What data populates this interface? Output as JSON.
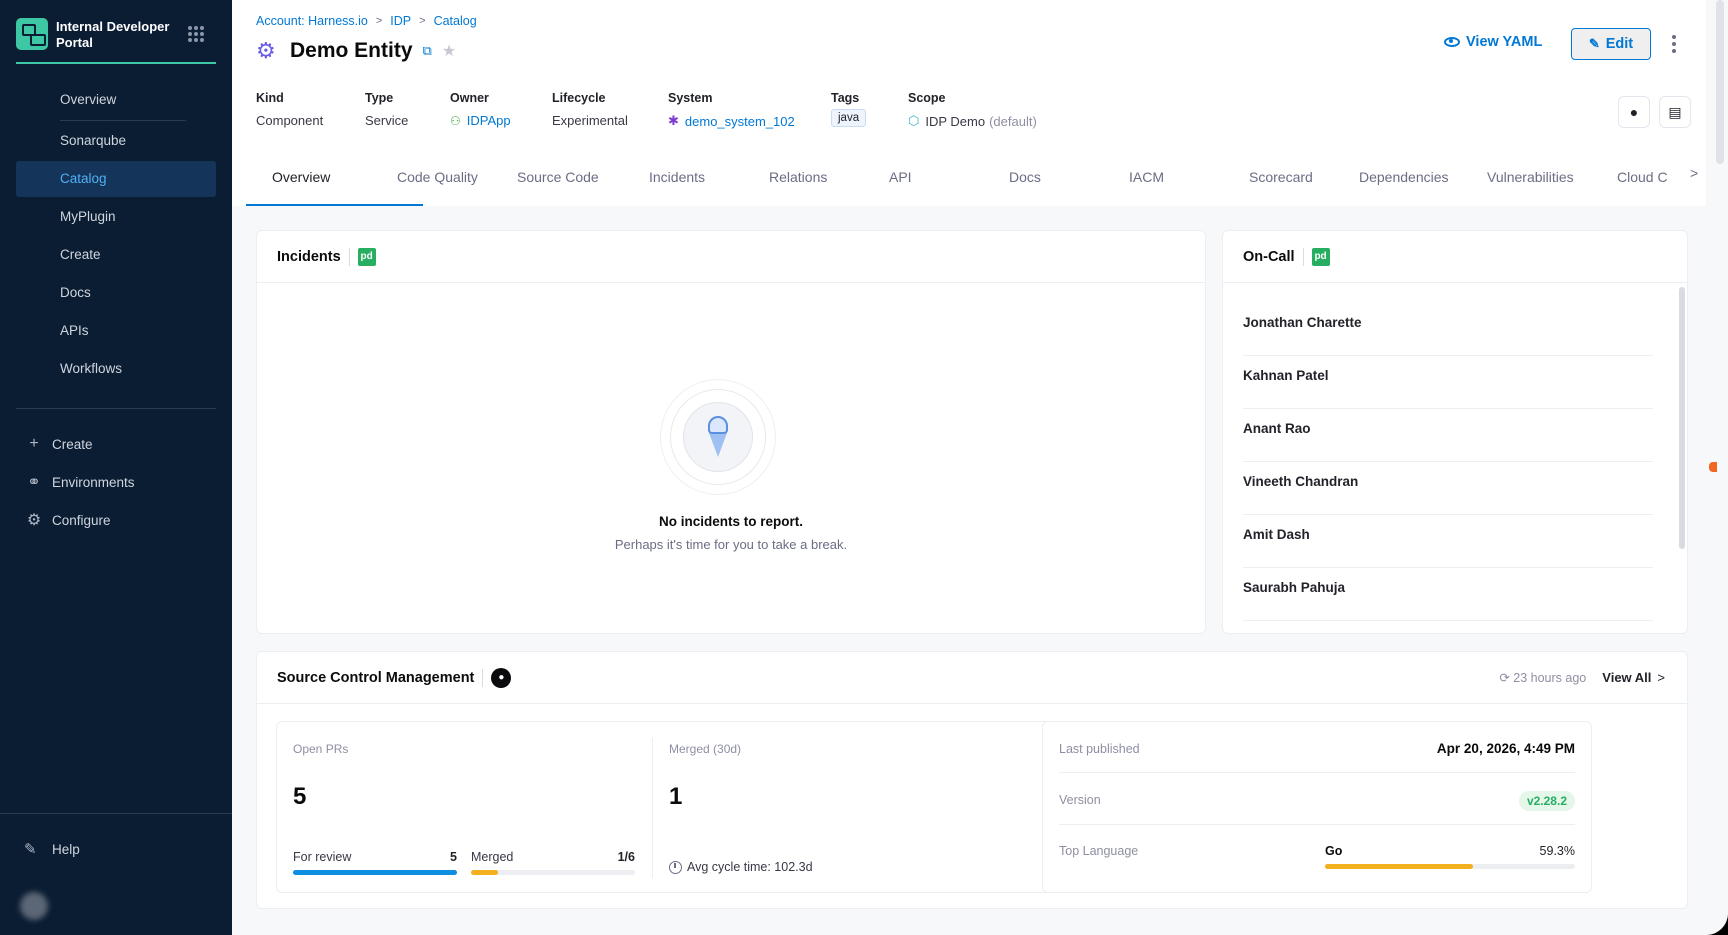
{
  "sidebar": {
    "brand": "Internal Developer Portal",
    "items": [
      {
        "label": "Overview"
      },
      {
        "label": "Sonarqube"
      },
      {
        "label": "Catalog"
      },
      {
        "label": "MyPlugin"
      },
      {
        "label": "Create"
      },
      {
        "label": "Docs"
      },
      {
        "label": "APIs"
      },
      {
        "label": "Workflows"
      }
    ],
    "active_item": "Catalog",
    "secondary": [
      {
        "label": "Create",
        "icon": "plus-icon"
      },
      {
        "label": "Environments",
        "icon": "environments-icon"
      },
      {
        "label": "Configure",
        "icon": "gear-icon"
      }
    ],
    "help": "Help"
  },
  "breadcrumb": [
    "Account: Harness.io",
    "IDP",
    "Catalog"
  ],
  "entity": {
    "title": "Demo Entity",
    "view_yaml": "View YAML",
    "edit": "Edit"
  },
  "meta": {
    "kind": {
      "label": "Kind",
      "value": "Component"
    },
    "type": {
      "label": "Type",
      "value": "Service"
    },
    "owner": {
      "label": "Owner",
      "value": "IDPApp"
    },
    "lifecycle": {
      "label": "Lifecycle",
      "value": "Experimental"
    },
    "system": {
      "label": "System",
      "value": "demo_system_102"
    },
    "tags": {
      "label": "Tags",
      "value": "java"
    },
    "scope": {
      "label": "Scope",
      "value": "IDP Demo",
      "suffix": "(default)"
    }
  },
  "tabs": [
    "Overview",
    "Code Quality",
    "Source Code",
    "Incidents",
    "Relations",
    "API",
    "Docs",
    "IACM",
    "Scorecard",
    "Dependencies",
    "Vulnerabilities",
    "Cloud C"
  ],
  "active_tab": "Overview",
  "incidents": {
    "title": "Incidents",
    "badge": "pd",
    "empty_title": "No incidents to report.",
    "empty_sub": "Perhaps it's time for you to take a break."
  },
  "oncall": {
    "title": "On-Call",
    "badge": "pd",
    "people": [
      "Jonathan Charette",
      "Kahnan Patel",
      "Anant Rao",
      "Vineeth Chandran",
      "Amit Dash",
      "Saurabh Pahuja"
    ]
  },
  "scm": {
    "title": "Source Control Management",
    "updated": "23 hours ago",
    "view_all": "View All",
    "open_prs": {
      "label": "Open PRs",
      "value": "5"
    },
    "merged": {
      "label": "Merged (30d)",
      "value": "1"
    },
    "for_review": {
      "label": "For review",
      "value": "5",
      "fraction": 1.0
    },
    "merged_ratio": {
      "label": "Merged",
      "value": "1/6",
      "fraction": 0.1667
    },
    "avg_cycle": "Avg cycle time: 102.3d",
    "last_published": {
      "label": "Last published",
      "value": "Apr 20, 2026, 4:49 PM"
    },
    "version": {
      "label": "Version",
      "value": "v2.28.2"
    },
    "top_language": {
      "label": "Top Language",
      "name": "Go",
      "value": "59.3%",
      "fraction": 0.593
    }
  },
  "colors": {
    "accent": "#0278d5",
    "sidebar_bg": "#0b1d33",
    "brand_green": "#3dc7a4",
    "review_bar": "#0d8ee0",
    "merged_bar": "#f2b01e",
    "language_bar": "#f2b01e"
  }
}
